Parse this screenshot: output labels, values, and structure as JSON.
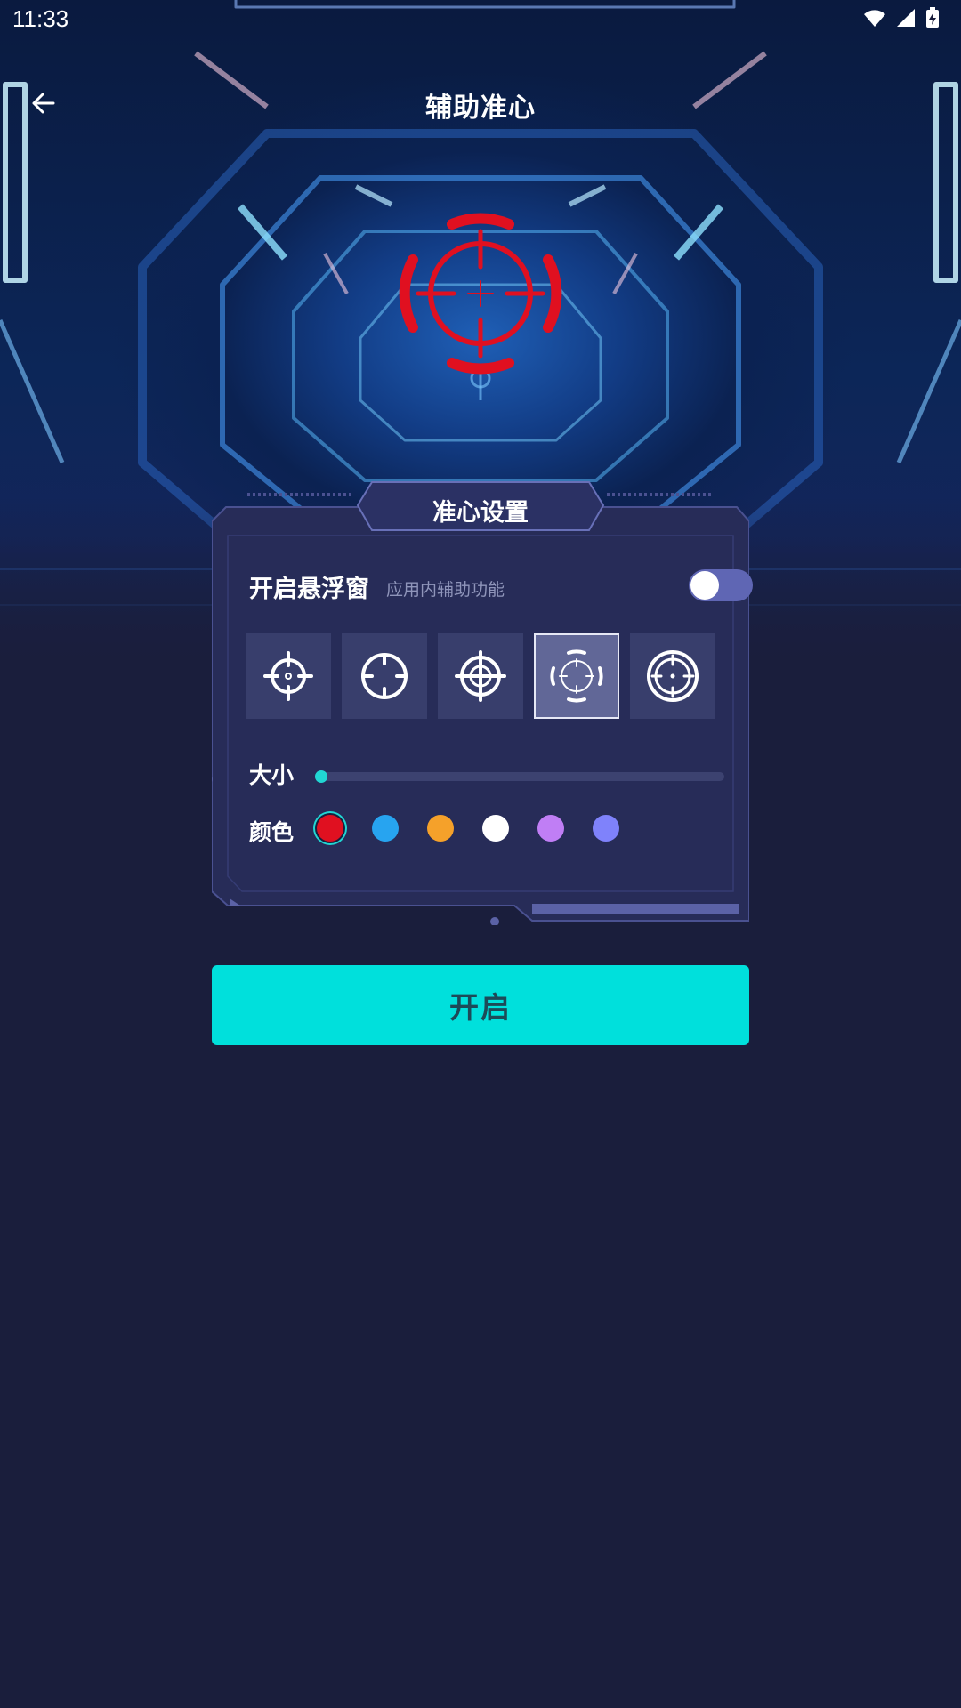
{
  "status_bar": {
    "time": "11:33",
    "icons": [
      "wifi-icon",
      "signal-icon",
      "battery-charging-icon"
    ]
  },
  "app_bar": {
    "title": "辅助准心",
    "back_icon": "arrow-left-icon"
  },
  "preview": {
    "crosshair_color": "#e01020",
    "style_index": 3
  },
  "panel": {
    "title": "准心设置",
    "floating_window": {
      "label": "开启悬浮窗",
      "sublabel": "应用内辅助功能",
      "enabled": false
    },
    "crosshair_styles": [
      {
        "icon": "crosshair-dot-icon",
        "selected": false
      },
      {
        "icon": "crosshair-circle-icon",
        "selected": false
      },
      {
        "icon": "crosshair-double-ring-icon",
        "selected": false
      },
      {
        "icon": "crosshair-bracket-ring-icon",
        "selected": true
      },
      {
        "icon": "crosshair-target-icon",
        "selected": false
      }
    ],
    "size": {
      "label": "大小",
      "value": 0.0
    },
    "color": {
      "label": "颜色",
      "options": [
        "#e01020",
        "#27a4f0",
        "#f5a12a",
        "#ffffff",
        "#c07ef5",
        "#7f82fb"
      ],
      "selected_index": 0
    }
  },
  "primary_button": {
    "label": "开启"
  },
  "theme": {
    "background": "#1a1e3c",
    "accent": "#00e0dc",
    "panel": "#272c58"
  }
}
